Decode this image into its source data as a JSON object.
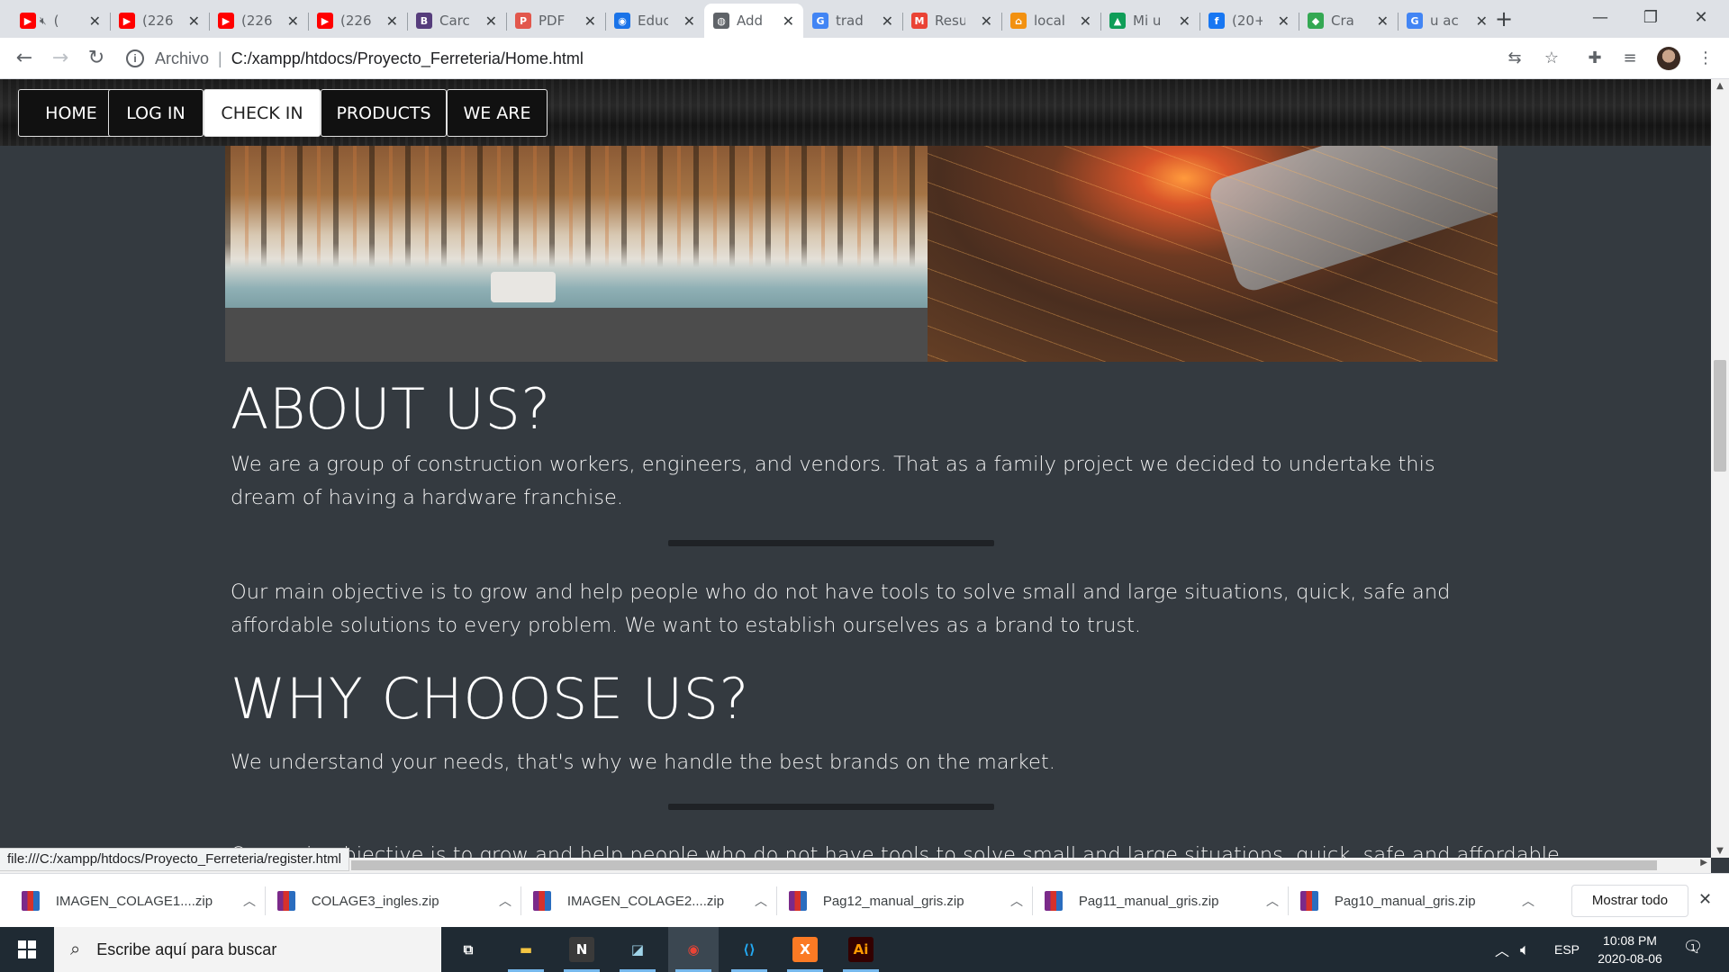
{
  "browser": {
    "tabs": [
      {
        "title": "(",
        "icon": "youtube-icon",
        "color": "#ff0000",
        "glyph": "▶",
        "extra": "mute-icon"
      },
      {
        "title": "(226",
        "icon": "youtube-icon",
        "color": "#ff0000",
        "glyph": "▶"
      },
      {
        "title": "(226",
        "icon": "youtube-icon",
        "color": "#ff0000",
        "glyph": "▶"
      },
      {
        "title": "(226",
        "icon": "youtube-icon",
        "color": "#ff0000",
        "glyph": "▶"
      },
      {
        "title": "Carc",
        "icon": "bootstrap-icon",
        "color": "#563d7c",
        "glyph": "B"
      },
      {
        "title": "PDF",
        "icon": "pdf-icon",
        "color": "#e2574c",
        "glyph": "P"
      },
      {
        "title": "Educ",
        "icon": "location-pin-icon",
        "color": "#1a73e8",
        "glyph": "◉"
      },
      {
        "title": "Add",
        "icon": "globe-icon",
        "color": "#5f6368",
        "glyph": "◍",
        "active": true
      },
      {
        "title": "trad",
        "icon": "google-icon",
        "color": "#4285f4",
        "glyph": "G"
      },
      {
        "title": "Resu",
        "icon": "gmail-icon",
        "color": "#ea4335",
        "glyph": "M"
      },
      {
        "title": "local",
        "icon": "xampp-pma-icon",
        "color": "#f29111",
        "glyph": "⌂"
      },
      {
        "title": "Mi u",
        "icon": "google-drive-icon",
        "color": "#0f9d58",
        "glyph": "▲"
      },
      {
        "title": "(20+",
        "icon": "facebook-icon",
        "color": "#1877f2",
        "glyph": "f"
      },
      {
        "title": "Cra",
        "icon": "google-maps-icon",
        "color": "#34a853",
        "glyph": "◆"
      },
      {
        "title": "u ac",
        "icon": "google-icon",
        "color": "#4285f4",
        "glyph": "G"
      }
    ],
    "new_tab": "+",
    "window_controls": {
      "minimize": "—",
      "restore": "❐",
      "close": "✕"
    },
    "address": {
      "scheme_label": "Archivo",
      "url": "C:/xampp/htdocs/Proyecto_Ferreteria/Home.html"
    },
    "status_link": "file:///C:/xampp/htdocs/Proyecto_Ferreteria/register.html"
  },
  "site": {
    "nav": [
      "HOME",
      "LOG IN",
      "CHECK IN",
      "PRODUCTS",
      "WE ARE"
    ],
    "nav_active": "CHECK IN",
    "about_title": "ABOUT US?",
    "about_text": "We are a group of construction workers, engineers, and vendors. That as a family project we decided to undertake this dream of having a hardware franchise.",
    "objective_text": "Our main objective is to grow and help people who do not have tools to solve small and large situations, quick, safe and affordable solutions to every problem. We want to establish ourselves as a brand to trust.",
    "why_title": "WHY CHOOSE US?",
    "why_text": "We understand your needs, that's why we handle the best brands on the market.",
    "cut_text": "Our main objective is to grow and help people who do not have tools to solve small and large situations, quick, safe and affordable"
  },
  "downloads": {
    "items": [
      "IMAGEN_COLAGE1....zip",
      "COLAGE3_ingles.zip",
      "IMAGEN_COLAGE2....zip",
      "Pag12_manual_gris.zip",
      "Pag11_manual_gris.zip",
      "Pag10_manual_gris.zip"
    ],
    "show_all": "Mostrar todo"
  },
  "taskbar": {
    "search_placeholder": "Escribe aquí para buscar",
    "apps": [
      {
        "name": "task-view-icon",
        "glyph": "⧉",
        "color": "#ffffff",
        "bg": "transparent"
      },
      {
        "name": "file-explorer-icon",
        "glyph": "▬",
        "color": "#f4c542",
        "bg": "transparent"
      },
      {
        "name": "notion-icon",
        "glyph": "N",
        "color": "#ffffff",
        "bg": "#3a3a3a"
      },
      {
        "name": "notes-app-icon",
        "glyph": "◪",
        "color": "#9fd3e8",
        "bg": "transparent"
      },
      {
        "name": "chrome-icon",
        "glyph": "◉",
        "color": "#ea4335",
        "bg": "transparent"
      },
      {
        "name": "vscode-icon",
        "glyph": "⟨⟩",
        "color": "#23a9f2",
        "bg": "transparent"
      },
      {
        "name": "xampp-icon",
        "glyph": "X",
        "color": "#ffffff",
        "bg": "#fb7a24"
      },
      {
        "name": "illustrator-icon",
        "glyph": "Ai",
        "color": "#ff9a00",
        "bg": "#330000"
      }
    ],
    "language": "ESP",
    "time": "10:08 PM",
    "date": "2020-08-06",
    "notifications": "1"
  }
}
